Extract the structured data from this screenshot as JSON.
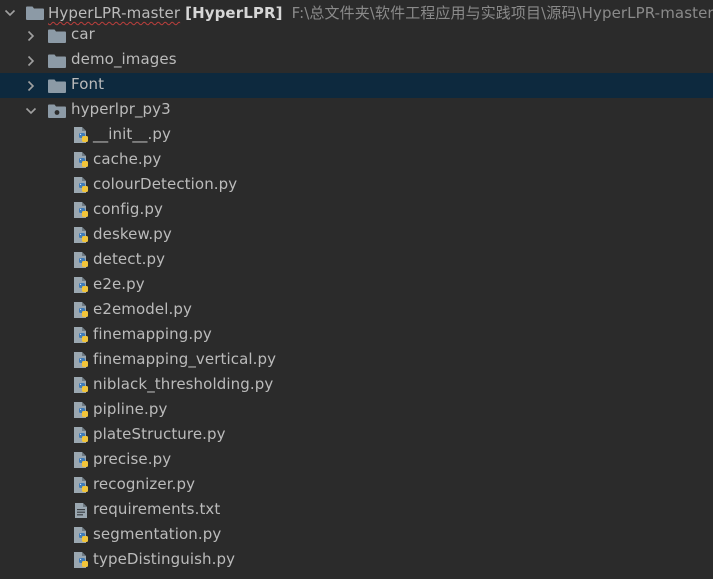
{
  "project_tree": {
    "root": {
      "name": "HyperLPR-master",
      "module": "[HyperLPR]",
      "path": "F:\\总文件夹\\软件工程应用与实践项目\\源码\\HyperLPR-master",
      "expanded": true,
      "folder_icon": "folder-icon"
    },
    "folders": [
      {
        "label": "car",
        "expanded": false,
        "selected": false,
        "icon": "folder-icon"
      },
      {
        "label": "demo_images",
        "expanded": false,
        "selected": false,
        "icon": "folder-icon"
      },
      {
        "label": "Font",
        "expanded": false,
        "selected": true,
        "icon": "folder-icon"
      },
      {
        "label": "hyperlpr_py3",
        "expanded": true,
        "selected": false,
        "icon": "package-folder-icon"
      }
    ],
    "files": [
      {
        "label": "__init__.py",
        "icon": "python-file-icon"
      },
      {
        "label": "cache.py",
        "icon": "python-file-icon"
      },
      {
        "label": "colourDetection.py",
        "icon": "python-file-icon"
      },
      {
        "label": "config.py",
        "icon": "python-file-icon"
      },
      {
        "label": "deskew.py",
        "icon": "python-file-icon"
      },
      {
        "label": "detect.py",
        "icon": "python-file-icon"
      },
      {
        "label": "e2e.py",
        "icon": "python-file-icon"
      },
      {
        "label": "e2emodel.py",
        "icon": "python-file-icon"
      },
      {
        "label": "finemapping.py",
        "icon": "python-file-icon"
      },
      {
        "label": "finemapping_vertical.py",
        "icon": "python-file-icon"
      },
      {
        "label": "niblack_thresholding.py",
        "icon": "python-file-icon"
      },
      {
        "label": "pipline.py",
        "icon": "python-file-icon"
      },
      {
        "label": "plateStructure.py",
        "icon": "python-file-icon"
      },
      {
        "label": "precise.py",
        "icon": "python-file-icon"
      },
      {
        "label": "recognizer.py",
        "icon": "python-file-icon"
      },
      {
        "label": "requirements.txt",
        "icon": "text-file-icon"
      },
      {
        "label": "segmentation.py",
        "icon": "python-file-icon"
      },
      {
        "label": "typeDistinguish.py",
        "icon": "python-file-icon"
      }
    ],
    "colors": {
      "background": "#2b2b2b",
      "selection": "#0d293e",
      "text": "#bbbbbb",
      "path_text": "#8a8a8a",
      "folder": "#8c9aa6",
      "python_blue": "#3d7ab8",
      "python_yellow": "#f0c43a",
      "spell_underline": "#bc3f3c"
    }
  }
}
